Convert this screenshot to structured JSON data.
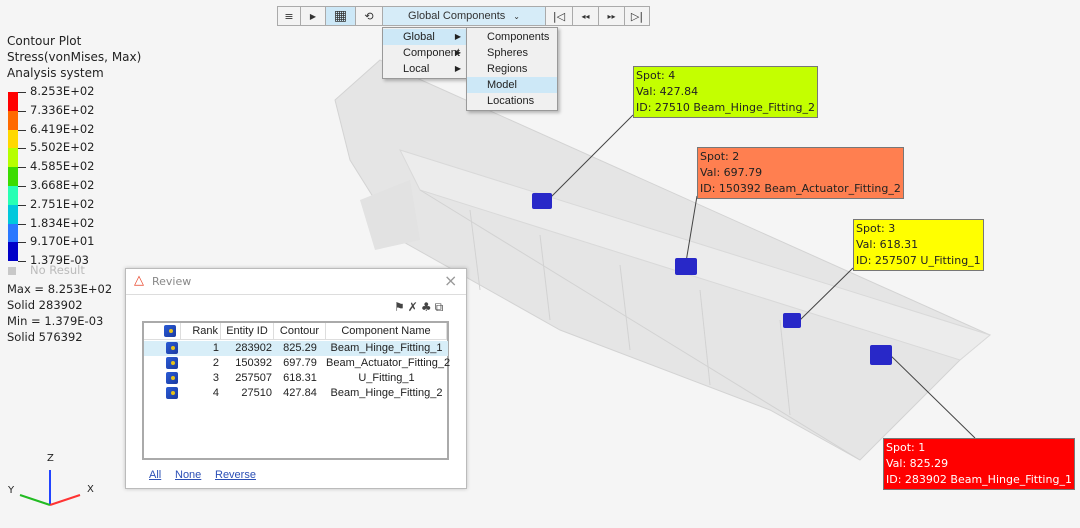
{
  "legend": {
    "title": [
      "Contour Plot",
      "Stress(vonMises, Max)",
      "Analysis system"
    ],
    "values": [
      "8.253E+02",
      "7.336E+02",
      "6.419E+02",
      "5.502E+02",
      "4.585E+02",
      "3.668E+02",
      "2.751E+02",
      "1.834E+02",
      "9.170E+01",
      "1.379E-03"
    ],
    "colors": [
      "#ff0000",
      "#ff6a00",
      "#ffd800",
      "#b6ff00",
      "#3cdc00",
      "#27ffb4",
      "#00c8dc",
      "#2a78ff",
      "#0000c8"
    ],
    "no_result": "No Result",
    "stats": [
      "Max =  8.253E+02",
      "Solid 283902",
      "Min =  1.379E-03",
      "Solid 576392"
    ]
  },
  "toolbar": {
    "menu_icon": "≡",
    "play_icon": "▶",
    "table_icon": "▦",
    "pick_icon": "⟲",
    "dropdown_label": "Global Components",
    "first_icon": "|◁",
    "prev_icon": "◂◂",
    "next_icon": "▸▸",
    "last_icon": "▷|"
  },
  "menu": {
    "items": [
      {
        "label": "Global"
      },
      {
        "label": "Component"
      },
      {
        "label": "Local"
      }
    ],
    "submenu": [
      {
        "label": "Components"
      },
      {
        "label": "Spheres"
      },
      {
        "label": "Regions"
      },
      {
        "label": "Model"
      },
      {
        "label": "Locations"
      }
    ]
  },
  "spots": [
    {
      "spot": "Spot: 4",
      "val": "Val: 427.84",
      "id": "ID: 27510 Beam_Hinge_Fitting_2",
      "color": "#c4ff00"
    },
    {
      "spot": "Spot: 2",
      "val": "Val: 697.79",
      "id": "ID: 150392 Beam_Actuator_Fitting_2",
      "color": "#ff7f50"
    },
    {
      "spot": "Spot: 3",
      "val": "Val: 618.31",
      "id": "ID: 257507 U_Fitting_1",
      "color": "#ffff00"
    },
    {
      "spot": "Spot: 1",
      "val": "Val: 825.29",
      "id": "ID: 283902 Beam_Hinge_Fitting_1",
      "color": "#ff0000"
    }
  ],
  "review": {
    "title": "Review",
    "columns": [
      "Rank",
      "Entity ID",
      "Contour",
      "Component Name"
    ],
    "rows": [
      {
        "rank": "1",
        "id": "283902",
        "contour": "825.29",
        "name": "Beam_Hinge_Fitting_1"
      },
      {
        "rank": "2",
        "id": "150392",
        "contour": "697.79",
        "name": "Beam_Actuator_Fitting_2"
      },
      {
        "rank": "3",
        "id": "257507",
        "contour": "618.31",
        "name": "U_Fitting_1"
      },
      {
        "rank": "4",
        "id": "27510",
        "contour": "427.84",
        "name": "Beam_Hinge_Fitting_2"
      }
    ],
    "links": [
      "All",
      "None",
      "Reverse"
    ]
  },
  "axes": {
    "z": "Z",
    "y": "Y",
    "x": "X"
  }
}
